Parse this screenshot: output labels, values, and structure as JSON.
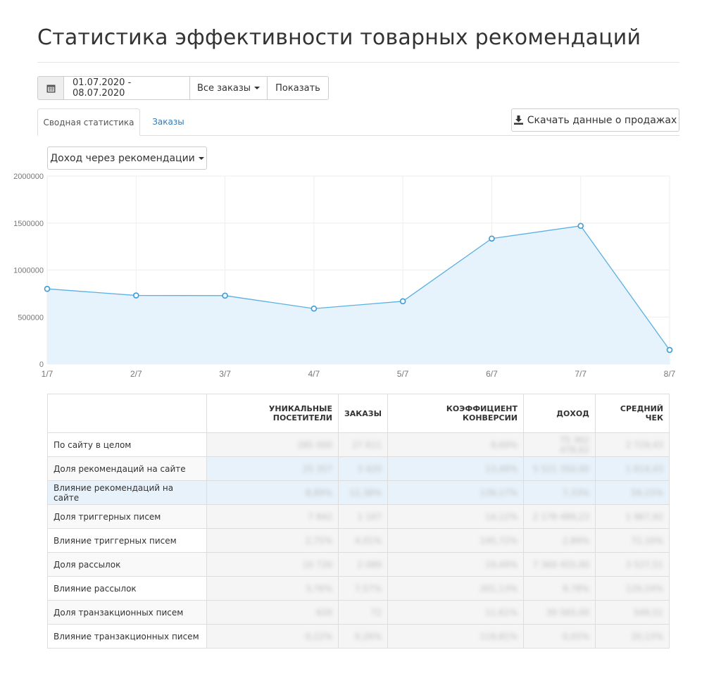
{
  "page": {
    "title": "Статистика эффективности товарных рекомендаций"
  },
  "filters": {
    "calendar_icon": "calendar-icon",
    "date_range": "01.07.2020 - 08.07.2020",
    "orders_filter": "Все заказы",
    "show_label": "Показать"
  },
  "tabs": [
    {
      "label": "Сводная статистика",
      "active": true
    },
    {
      "label": "Заказы",
      "active": false
    }
  ],
  "download": {
    "icon": "download-icon",
    "label": "Скачать данные о продажах"
  },
  "metric_select": {
    "label": "Доход через рекомендации"
  },
  "colors": {
    "line": "#5bb0e4",
    "fill": "#e6f2fc",
    "highlight_row": "#e8f2fb"
  },
  "chart_data": {
    "type": "area",
    "x": [
      "1/7",
      "2/7",
      "3/7",
      "4/7",
      "5/7",
      "6/7",
      "7/7",
      "8/7"
    ],
    "values": [
      800000,
      730000,
      728000,
      590000,
      668000,
      1335000,
      1470000,
      150000
    ],
    "yticks": [
      "2000000",
      "1500000",
      "1000000",
      "500000",
      "0"
    ],
    "ylim": [
      0,
      2000000
    ],
    "grid": true
  },
  "table": {
    "headers": [
      "",
      "Уникальные посетители",
      "Заказы",
      "Коэффициент конверсии",
      "Доход",
      "Средний чек"
    ],
    "rows": [
      {
        "label": "По сайту в целом",
        "values": [
          "285 000",
          "27 611",
          "9,69%",
          "75 362 478,62",
          "2 729,43"
        ],
        "highlight": false
      },
      {
        "label": "Доля рекомендаций на сайте",
        "values": [
          "25 357",
          "3 420",
          "13,49%",
          "5 521 350,00",
          "1 614,43"
        ],
        "highlight": true
      },
      {
        "label": "Влияние рекомендаций на сайте",
        "values": [
          "8,89%",
          "12,38%",
          "139,17%",
          "7,33%",
          "59,15%"
        ],
        "highlight": true
      },
      {
        "label": "Доля триггерных писем",
        "values": [
          "7 842",
          "1 107",
          "14,12%",
          "2 178 489,23",
          "1 967,92"
        ],
        "highlight": false
      },
      {
        "label": "Влияние триггерных писем",
        "values": [
          "2,75%",
          "4,01%",
          "145,72%",
          "2,89%",
          "72,10%"
        ],
        "highlight": false
      },
      {
        "label": "Доля рассылок",
        "values": [
          "10 720",
          "2 089",
          "19,49%",
          "7 369 455,00",
          "3 527,51"
        ],
        "highlight": false
      },
      {
        "label": "Влияние рассылок",
        "values": [
          "3,76%",
          "7,57%",
          "201,13%",
          "9,78%",
          "129,24%"
        ],
        "highlight": false
      },
      {
        "label": "Доля транзакционных писем",
        "values": [
          "620",
          "72",
          "11,61%",
          "39 565,00",
          "549,51"
        ],
        "highlight": false
      },
      {
        "label": "Влияние транзакционных писем",
        "values": [
          "0,22%",
          "0,26%",
          "119,81%",
          "0,05%",
          "20,13%"
        ],
        "highlight": false
      }
    ]
  }
}
